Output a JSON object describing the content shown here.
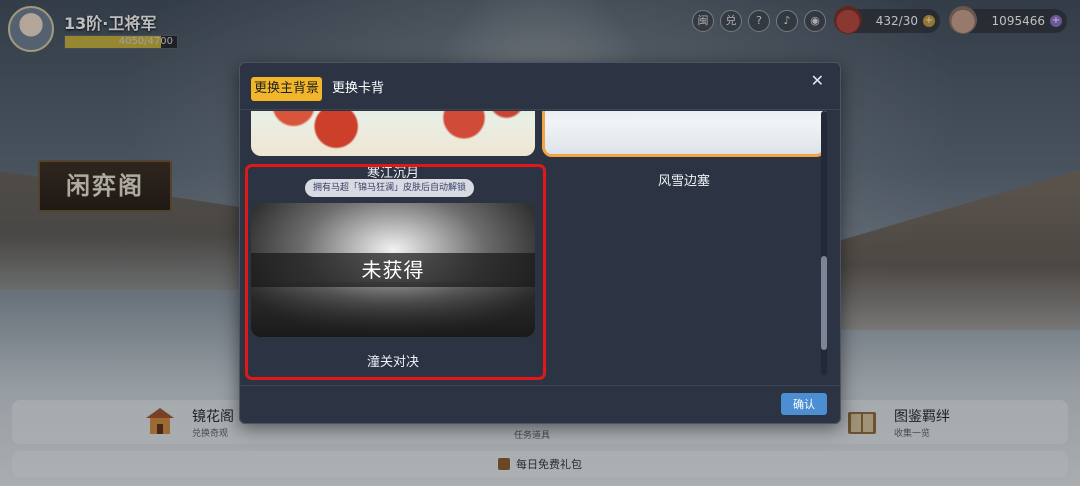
{
  "hud": {
    "rank_title": "13阶·卫将军",
    "exp_text": "4050/4700",
    "exp_fraction": 0.86,
    "icons": [
      {
        "name": "guard-icon",
        "glyph": "闽"
      },
      {
        "name": "exchange-icon",
        "glyph": "兑"
      },
      {
        "name": "help-icon",
        "glyph": "?"
      },
      {
        "name": "music-icon",
        "glyph": "♪"
      },
      {
        "name": "view-icon",
        "glyph": "◉"
      }
    ],
    "currency_bag": {
      "value": "432/30",
      "icon": "money-bag-icon",
      "color": "#b8453b"
    },
    "currency_coins": {
      "value": "1095466",
      "icon": "coin-pile-icon",
      "color": "#c9a08a"
    }
  },
  "pavilion_sign": "闲弈阁",
  "modal": {
    "tabs": [
      {
        "label": "更换主背景",
        "active": true
      },
      {
        "label": "更换卡背",
        "active": false
      }
    ],
    "close_glyph": "✕",
    "cards": [
      {
        "label": "寒江沉月",
        "state": "owned"
      },
      {
        "label": "风雪边塞",
        "state": "selected"
      },
      {
        "label": "潼关对决",
        "state": "locked",
        "badge": "拥有马超「锦马狂澜」皮肤后自动解锁",
        "overlay": "未获得"
      }
    ],
    "confirm_label": "确认",
    "scroll_fraction": 0.85
  },
  "bottom_menu": {
    "left": {
      "title": "镜花阁",
      "subtitle": "兑换奇观",
      "icon": "pavilion-icon"
    },
    "middle_sub": "任务道具",
    "right": {
      "title": "图鉴羁绊",
      "subtitle": "收集一览",
      "icon": "book-icon"
    },
    "gift_label": "每日免费礼包"
  },
  "colors": {
    "accent_tab": "#f2b62b",
    "confirm": "#4b8ed1",
    "highlight": "#e01818",
    "selected_border": "#f2a444"
  }
}
